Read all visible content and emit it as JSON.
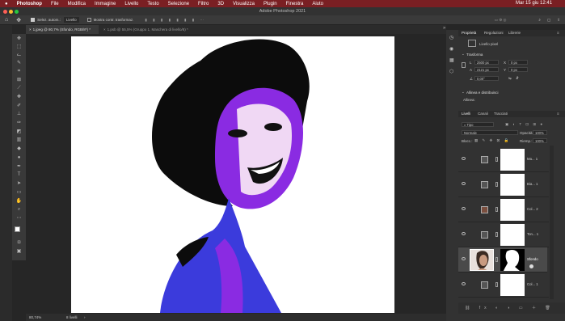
{
  "menubar": {
    "apple": "",
    "app": "Photoshop",
    "items": [
      "File",
      "Modifica",
      "Immagine",
      "Livello",
      "Testo",
      "Selezione",
      "Filtro",
      "3D",
      "Visualizza",
      "Plugin",
      "Finestra",
      "Aiuto"
    ],
    "clock": "Mar 15 giu  12:41"
  },
  "window": {
    "title": "Adobe Photoshop 2021"
  },
  "options": {
    "autoselect": "Selez. autom.:",
    "layer_dropdown": "Livello",
    "transform": "Mostra contr. trasformaz."
  },
  "tabs": [
    {
      "label": "1.jpeg @ 80,7% (Sfondo, RGB/8*) *",
      "active": true
    },
    {
      "label": "1.psb @ 55,5% (Gruppo 1, Maschera di livello/8) *",
      "active": false
    }
  ],
  "status": {
    "zoom": "80,74%",
    "info": "8 livelli"
  },
  "panel": {
    "tabs": [
      "Proprietà",
      "Regolazioni",
      "Librerie"
    ],
    "pixel_layer": "Livello pixel",
    "transform_title": "Trasforma",
    "w": "2500 px",
    "x": "0 px",
    "h": "2121 px",
    "y": "0 px",
    "angle": "0,00°",
    "align_title": "Allinea e distribuisci",
    "align_label": "Allinea:",
    "layers_tabs": [
      "Livelli",
      "Canali",
      "Tracciati"
    ],
    "kind": "Tipo",
    "blend": "Normale",
    "opacity_label": "Opacità:",
    "opacity": "100%",
    "lock_label": "Blocc.:",
    "fill_label": "Riemp.:",
    "fill": "100%",
    "layers": [
      {
        "name": "Ma... 1",
        "thumb": "adjustment"
      },
      {
        "name": "Bia... 1",
        "thumb": "adjustment"
      },
      {
        "name": "Col... 2",
        "thumb": "color"
      },
      {
        "name": "Ton... 1",
        "thumb": "adjustment"
      },
      {
        "name": "Sfondo",
        "thumb": "photo"
      },
      {
        "name": "Col... 1",
        "thumb": "adjustment"
      }
    ]
  }
}
